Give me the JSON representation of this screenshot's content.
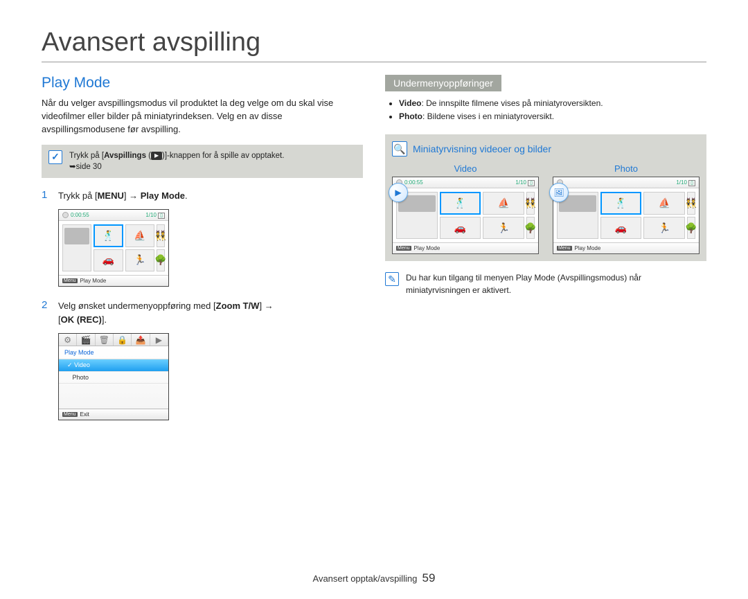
{
  "title": "Avansert avspilling",
  "section_heading": "Play Mode",
  "intro": "Når du velger avspillingsmodus vil produktet la deg velge om du skal vise videofilmer eller bilder på miniatyrindeksen. Velg en av disse avspillingsmodusene før avspilling.",
  "tip": {
    "line1_pre": "Trykk på [",
    "line1_bold": "Avspillings",
    "line1_post": " (",
    "line1_end": ")]-knappen for å spille av opptaket.",
    "page_ref": "➥side 30"
  },
  "steps": [
    {
      "num": "1",
      "pre": "Trykk på [",
      "b1": "MENU",
      "mid": "] ",
      "arrow": "→",
      "b2": " Play Mode",
      "post": "."
    },
    {
      "num": "2",
      "pre": "Velg ønsket undermenyoppføring med [",
      "b1": "Zoom T/W",
      "mid": "] ",
      "arrow": "→",
      "line2_pre": "[",
      "b2": "OK (REC)",
      "line2_post": "]."
    }
  ],
  "shot1": {
    "time": "0:00:55",
    "counter": "1/10",
    "footer_label": "Play Mode",
    "menu_chip": "Menu"
  },
  "shot2": {
    "section_label": "Play Mode",
    "row_video": "Video",
    "row_photo": "Photo",
    "footer_label": "Exit",
    "menu_chip": "Menu"
  },
  "right": {
    "banner": "Undermenyoppføringer",
    "bullets": [
      {
        "b": "Video",
        "t": ": De innspilte filmene vises på miniatyroversikten."
      },
      {
        "b": "Photo",
        "t": ": Bildene vises i en miniatyroversikt."
      }
    ],
    "overview_heading": "Miniatyrvisning videoer og bilder",
    "video_label": "Video",
    "photo_label": "Photo",
    "ov_time": "0:00:55",
    "ov_counter": "1/10",
    "ov_counter2": "1/10",
    "ov_footer": "Play Mode",
    "ov_menu_chip": "Menu",
    "note": "Du har kun tilgang til menyen Play Mode (Avspillingsmodus) når miniatyrvisningen er aktivert."
  },
  "footer": {
    "text": "Avansert opptak/avspilling",
    "page": "59"
  }
}
